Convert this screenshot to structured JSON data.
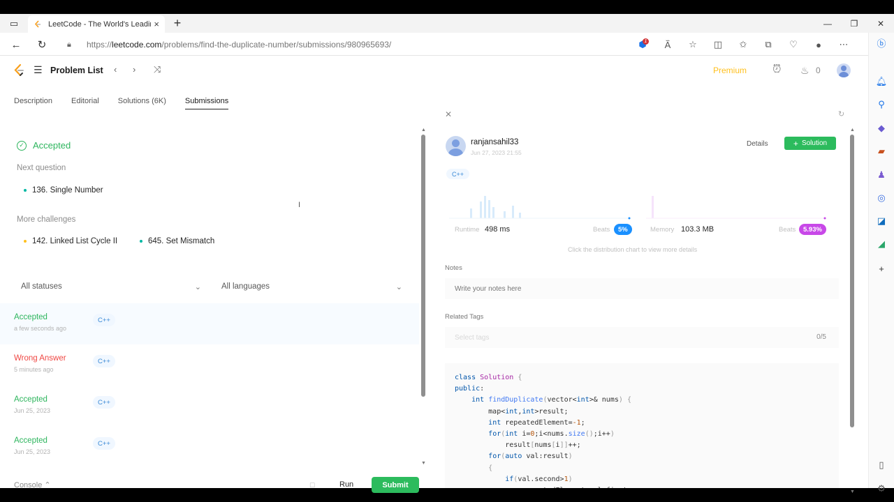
{
  "browser": {
    "tab_title": "LeetCode - The World's Leading",
    "url_prefix": "https://",
    "url_host": "leetcode.com",
    "url_path": "/problems/find-the-duplicate-number/submissions/980965693/",
    "notification_count": "1"
  },
  "header": {
    "problem_list": "Problem List",
    "premium": "Premium",
    "streak": "0"
  },
  "left": {
    "tabs": [
      "Description",
      "Editorial",
      "Solutions (6K)",
      "Submissions"
    ],
    "result_status": "Accepted",
    "next_question_label": "Next question",
    "next_question": "136. Single Number",
    "more_challenges_label": "More challenges",
    "challenges": [
      "142. Linked List Cycle II",
      "645. Set Mismatch"
    ],
    "filter_status": "All statuses",
    "filter_language": "All languages",
    "submissions": [
      {
        "status": "Accepted",
        "time": "a few seconds ago",
        "lang": "C++"
      },
      {
        "status": "Wrong Answer",
        "time": "5 minutes ago",
        "lang": "C++"
      },
      {
        "status": "Accepted",
        "time": "Jun 25, 2023",
        "lang": "C++"
      },
      {
        "status": "Accepted",
        "time": "Jun 25, 2023",
        "lang": "C++"
      }
    ],
    "console": "Console",
    "run": "Run",
    "submit": "Submit"
  },
  "right": {
    "username": "ranjansahil33",
    "date": "Jun 27, 2023 21:55",
    "details": "Details",
    "solution": "Solution",
    "language": "C++",
    "runtime_label": "Runtime",
    "runtime_value": "498 ms",
    "runtime_beats_label": "Beats",
    "runtime_beats": "5%",
    "memory_label": "Memory",
    "memory_value": "103.3 MB",
    "memory_beats_label": "Beats",
    "memory_beats": "5.93%",
    "chart_hint": "Click the distribution chart to view more details",
    "notes_label": "Notes",
    "notes_placeholder": "Write your notes here",
    "tags_label": "Related Tags",
    "tags_placeholder": "Select tags",
    "tags_count": "0/5"
  },
  "colors": {
    "accepted": "#2db55d",
    "wrong": "#ef4743",
    "submit": "#2cbb5d",
    "runtime_pill": "#1a90ff",
    "memory_pill": "#c848e8",
    "premium": "#ffc01e"
  }
}
